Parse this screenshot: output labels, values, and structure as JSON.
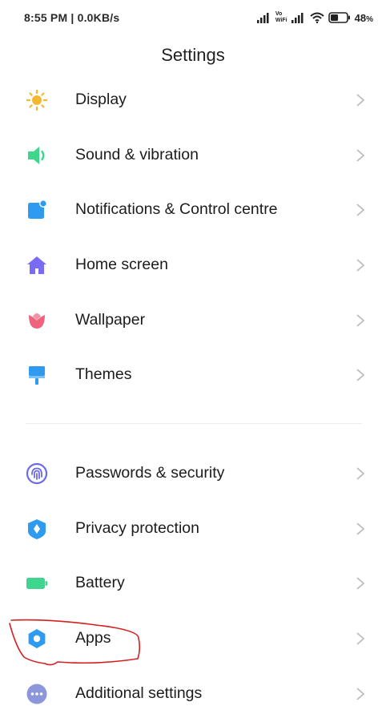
{
  "status_bar": {
    "time_speed": "8:55 PM | 0.0KB/s",
    "vowifi_line1": "Vo",
    "vowifi_line2": "WiFi",
    "battery_percent": "48",
    "battery_percent_suffix": "%",
    "battery_level": 0.48
  },
  "header": {
    "title": "Settings"
  },
  "groups": [
    {
      "items": [
        {
          "label": "Display",
          "icon": "sun-icon",
          "color": "#F5B730"
        },
        {
          "label": "Sound & vibration",
          "icon": "speaker-icon",
          "color": "#3DD68C"
        },
        {
          "label": "Notifications & Control centre",
          "icon": "notification-icon",
          "color": "#2F9BF0"
        },
        {
          "label": "Home screen",
          "icon": "home-icon",
          "color": "#7A6BF5"
        },
        {
          "label": "Wallpaper",
          "icon": "tulip-icon",
          "color": "#F0637E"
        },
        {
          "label": "Themes",
          "icon": "paintbrush-icon",
          "color": "#2F9BF0"
        }
      ]
    },
    {
      "items": [
        {
          "label": "Passwords & security",
          "icon": "fingerprint-icon",
          "color": "#6B6BE8"
        },
        {
          "label": "Privacy protection",
          "icon": "shield-icon",
          "color": "#2F9BF0"
        },
        {
          "label": "Battery",
          "icon": "battery-icon",
          "color": "#3DD68C"
        },
        {
          "label": "Apps",
          "icon": "gear-icon",
          "color": "#2F9BF0"
        },
        {
          "label": "Additional settings",
          "icon": "more-dots-icon",
          "color": "#8B96DB"
        }
      ]
    }
  ],
  "annotation_color": "#D42020",
  "chevron_color": "#BDBDBD"
}
